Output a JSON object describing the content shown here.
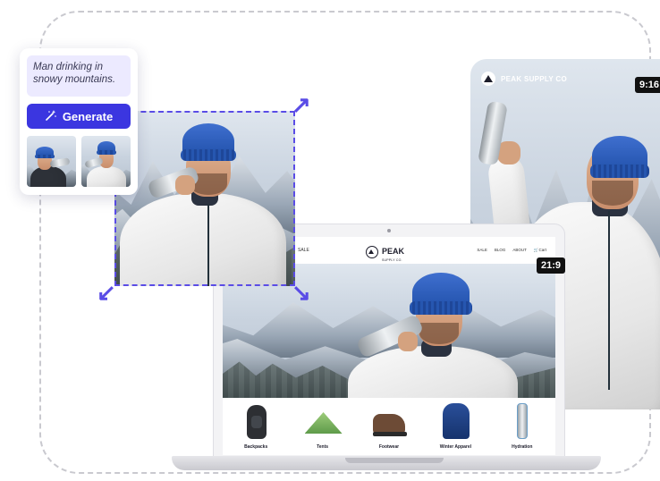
{
  "prompt_card": {
    "prompt_text": "Man drinking in snowy mountains.",
    "generate_label": "Generate",
    "button_color": "#3b36e0",
    "thumbnails": [
      "thumbnail-variant-1",
      "thumbnail-variant-2"
    ]
  },
  "phone": {
    "brand": "PEAK SUPPLY CO",
    "aspect_ratio": "9:16"
  },
  "laptop": {
    "aspect_ratio": "21:9",
    "nav": {
      "left_link": "SALE",
      "logo": "PEAK",
      "logo_sub": "SUPPLY CO.",
      "links": [
        "SALE",
        "BLOG",
        "ABOUT",
        "Cart"
      ]
    },
    "products": [
      {
        "label": "Backpacks",
        "icon": "backpack-icon"
      },
      {
        "label": "Tents",
        "icon": "tent-icon"
      },
      {
        "label": "Footwear",
        "icon": "boot-icon"
      },
      {
        "label": "Winter Apparel",
        "icon": "jacket-icon"
      },
      {
        "label": "Hydration",
        "icon": "water-bottle-icon"
      }
    ]
  },
  "colors": {
    "accent": "#5a4ce6",
    "prompt_bg": "#eceaff"
  }
}
